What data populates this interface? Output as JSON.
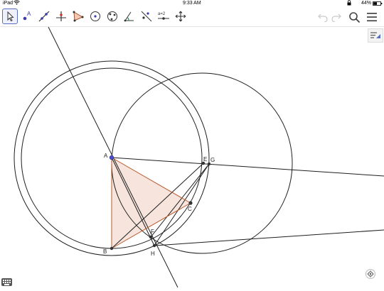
{
  "status_bar": {
    "device": "iPad",
    "time": "9:33 AM",
    "battery": "44%"
  },
  "toolbar": {
    "tools": [
      {
        "name": "move-tool-icon",
        "selected": true
      },
      {
        "name": "point-tool-icon",
        "glyph": "A"
      },
      {
        "name": "line-tool-icon"
      },
      {
        "name": "perpendicular-line-tool-icon"
      },
      {
        "name": "polygon-tool-icon"
      },
      {
        "name": "circle-center-point-tool-icon"
      },
      {
        "name": "circle-three-points-tool-icon"
      },
      {
        "name": "angle-tool-icon"
      },
      {
        "name": "reflect-tool-icon"
      },
      {
        "name": "slider-tool-icon",
        "glyph": "a=2"
      },
      {
        "name": "move-graphics-view-tool-icon"
      }
    ],
    "right": [
      "undo-icon",
      "redo-icon",
      "search-icon",
      "menu-icon"
    ]
  },
  "construction": {
    "points": [
      {
        "label": "A"
      },
      {
        "label": "B"
      },
      {
        "label": "C"
      },
      {
        "label": "E"
      },
      {
        "label": "F"
      },
      {
        "label": "G"
      },
      {
        "label": "H"
      }
    ],
    "colors": {
      "point_blue": "#4d4dd0",
      "point_dark": "#333333",
      "triangle_fill": "#f7e4dd",
      "triangle_stroke": "#b85c2e",
      "line": "#1e1e1e"
    }
  },
  "bottom": {
    "keyboard_icon": "keyboard-icon",
    "recenter_icon": "recenter-view-icon"
  }
}
